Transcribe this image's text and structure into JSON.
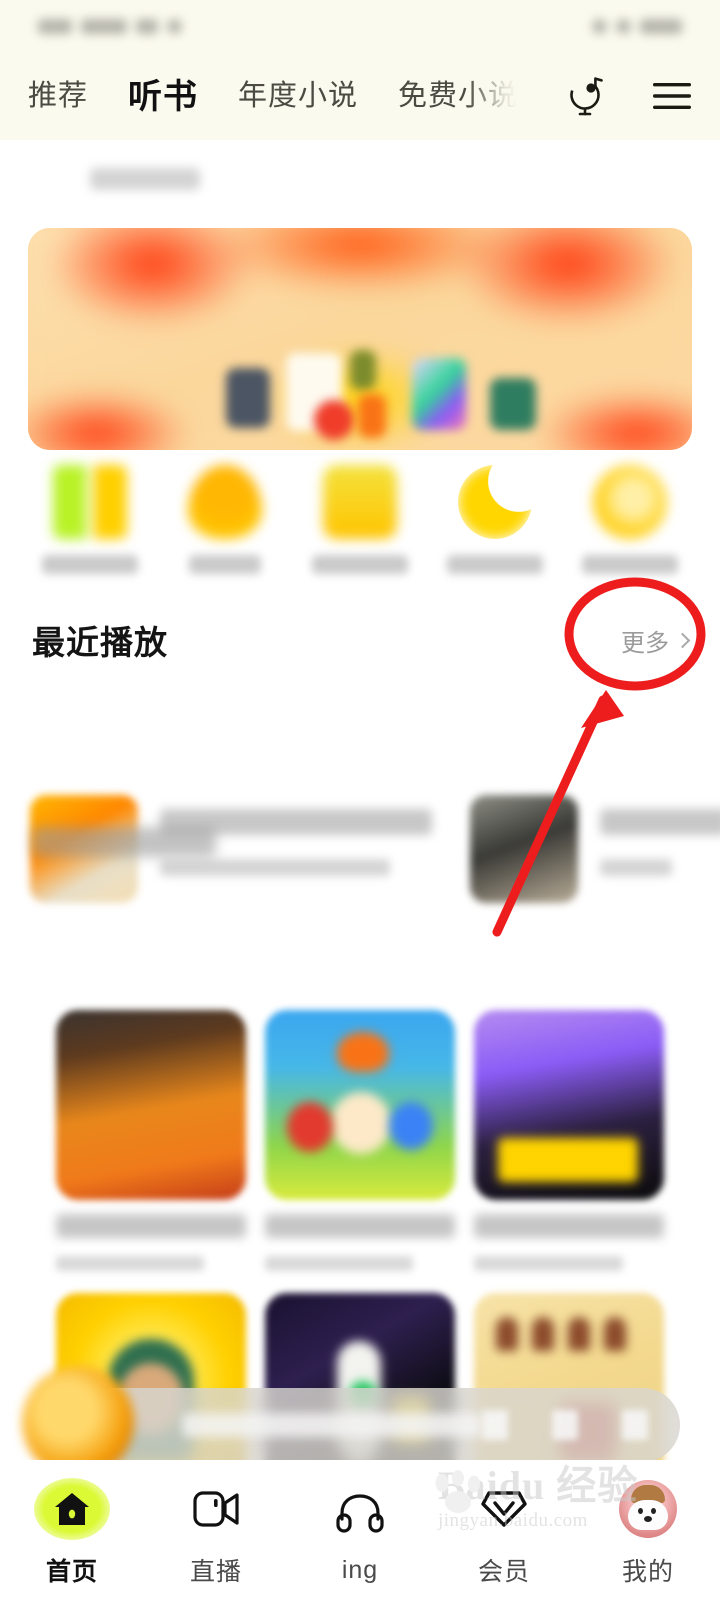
{
  "app": {
    "accent_yellow": "#e3f53c",
    "accent_home": "#dcf936",
    "header_bg": "#fbfaee",
    "annotation_red": "#ee1d1d"
  },
  "topnav": {
    "tabs": [
      {
        "label": "推荐",
        "active": false
      },
      {
        "label": "听书",
        "active": true
      },
      {
        "label": "年度小说",
        "active": false
      },
      {
        "label": "免费小说",
        "active": false,
        "clipped": true
      }
    ],
    "actions": [
      {
        "name": "voice-search-icon",
        "label": "语音"
      },
      {
        "name": "menu-icon",
        "label": "菜单"
      }
    ]
  },
  "sections": {
    "recent": {
      "title": "最近播放",
      "more_label": "更多",
      "items": [
        {
          "name": "recent-item-1"
        },
        {
          "name": "recent-item-2"
        }
      ]
    },
    "recommend": {
      "title": ""
    }
  },
  "quick_access": [
    {
      "name": "quick-item-1"
    },
    {
      "name": "quick-item-2"
    },
    {
      "name": "quick-item-3"
    },
    {
      "name": "quick-item-4"
    },
    {
      "name": "quick-item-5"
    }
  ],
  "grid": {
    "cards": [
      {
        "name": "book-card-1"
      },
      {
        "name": "book-card-2"
      },
      {
        "name": "book-card-3"
      },
      {
        "name": "book-card-4"
      },
      {
        "name": "book-card-5"
      },
      {
        "name": "book-card-6"
      }
    ]
  },
  "mini_player": {
    "controls": [
      "pause",
      "next",
      "list"
    ]
  },
  "tabbar": [
    {
      "label": "首页",
      "icon": "home-icon",
      "active": true
    },
    {
      "label": "直播",
      "icon": "video-camera-icon",
      "active": false
    },
    {
      "label": "ing",
      "icon": "headphones-icon",
      "active": false
    },
    {
      "label": "会员",
      "icon": "vip-diamond-icon",
      "active": false
    },
    {
      "label": "我的",
      "icon": "avatar-icon",
      "active": false
    }
  ],
  "watermark": {
    "main": "Baidu 经验",
    "sub": "jingyan.baidu.com"
  },
  "annotation": {
    "type": "red-circle-with-arrow",
    "target": "更多"
  }
}
